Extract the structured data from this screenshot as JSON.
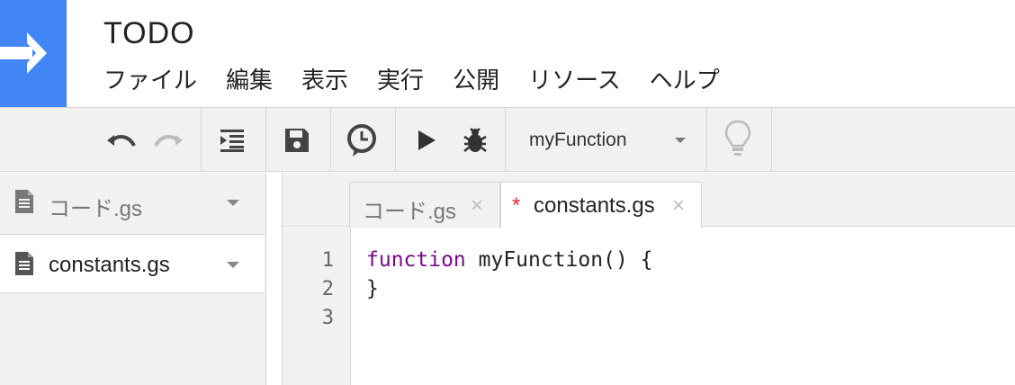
{
  "app": {
    "title": "TODO",
    "menu": [
      "ファイル",
      "編集",
      "表示",
      "実行",
      "公開",
      "リソース",
      "ヘルプ"
    ]
  },
  "toolbar": {
    "function_select": "myFunction",
    "icons": [
      "undo-icon",
      "redo-icon",
      "indent-icon",
      "save-icon",
      "timer-trigger-icon",
      "run-icon",
      "debug-icon",
      "lightbulb-icon"
    ]
  },
  "sidebar": {
    "files": [
      {
        "name": "コード.gs",
        "selected": false
      },
      {
        "name": "constants.gs",
        "selected": true
      }
    ]
  },
  "tabs": [
    {
      "label": "コード.gs",
      "modified": false,
      "active": false,
      "close": "×"
    },
    {
      "label": "constants.gs",
      "modified": true,
      "modified_mark": "*",
      "active": true,
      "close": "×"
    }
  ],
  "editor": {
    "line_numbers": [
      "1",
      "2",
      "3"
    ],
    "lines": [
      {
        "keyword": "function",
        "rest": " myFunction() {"
      },
      {
        "keyword": "",
        "rest": "}"
      },
      {
        "keyword": "",
        "rest": ""
      }
    ]
  },
  "colors": {
    "logo_bg": "#4285f4",
    "keyword": "#7a0a8a",
    "modified_mark": "#e03030"
  }
}
